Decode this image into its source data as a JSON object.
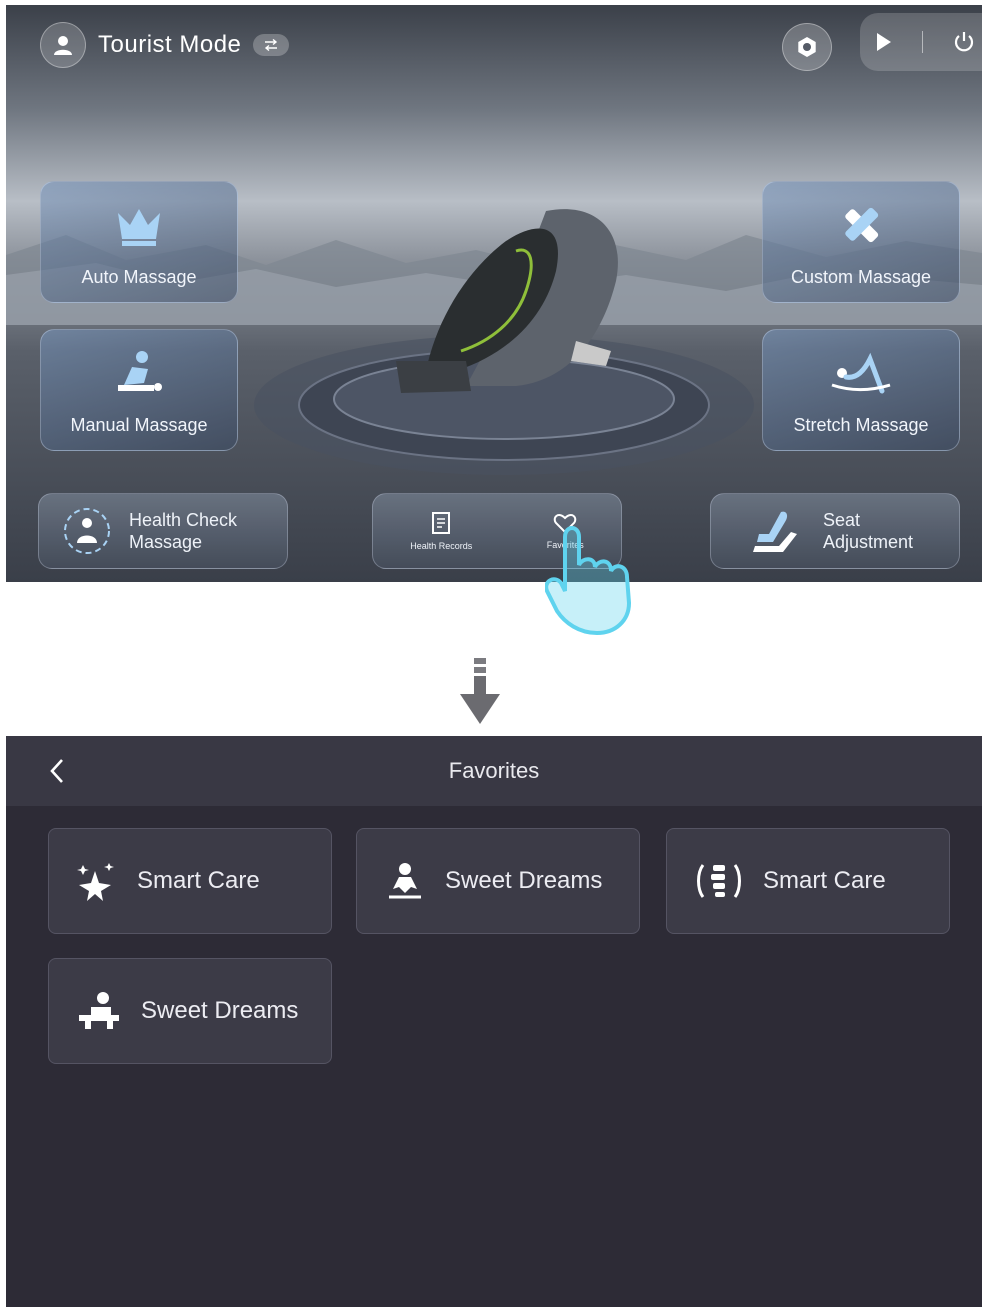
{
  "top_screen": {
    "header": {
      "mode_label": "Tourist Mode"
    },
    "mode_cards": [
      {
        "id": "auto",
        "label": "Auto Massage",
        "icon": "crown-icon"
      },
      {
        "id": "custom",
        "label": "Custom Massage",
        "icon": "tools-icon"
      },
      {
        "id": "manual",
        "label": "Manual Massage",
        "icon": "masseur-icon"
      },
      {
        "id": "stretch",
        "label": "Stretch Massage",
        "icon": "stretch-icon"
      }
    ],
    "health_check": {
      "line1": "Health Check",
      "line2": "Massage"
    },
    "center_pill": {
      "records_label": "Health Records",
      "favorites_label": "Favorites"
    },
    "seat_adjustment": {
      "line1": "Seat",
      "line2": "Adjustment"
    }
  },
  "bottom_screen": {
    "title": "Favorites",
    "items": [
      {
        "label": "Smart Care",
        "icon": "sparkles-icon"
      },
      {
        "label": "Sweet Dreams",
        "icon": "sleep-person-icon"
      },
      {
        "label": "Smart Care",
        "icon": "spine-icon"
      },
      {
        "label": "Sweet Dreams",
        "icon": "massage-bed-icon"
      }
    ]
  },
  "colors": {
    "favorites_bg": "#2d2b36",
    "favorites_header": "#393844",
    "card_bg": "#3c3b47",
    "hand_accent": "#5fd3ee"
  }
}
